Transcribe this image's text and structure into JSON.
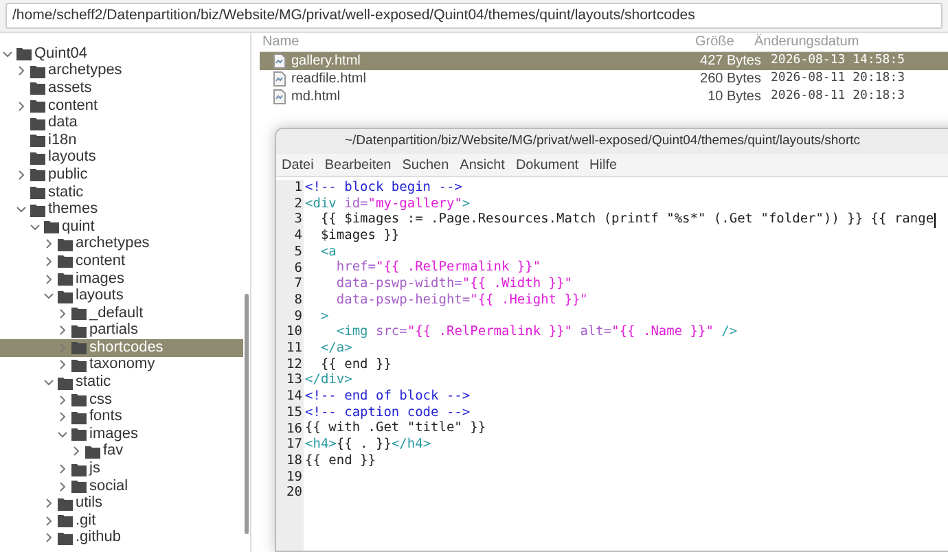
{
  "path_bar": {
    "value": "/home/scheff2/Datenpartition/biz/Website/MG/privat/well-exposed/Quint04/themes/quint/layouts/shortcodes"
  },
  "tree": [
    {
      "label": "Quint04",
      "expanded": true,
      "selected": false,
      "children": [
        {
          "label": "archetypes",
          "expanded": false,
          "selected": false
        },
        {
          "label": "assets",
          "selected": false
        },
        {
          "label": "content",
          "expanded": false,
          "selected": false
        },
        {
          "label": "data",
          "selected": false
        },
        {
          "label": "i18n",
          "selected": false
        },
        {
          "label": "layouts",
          "selected": false
        },
        {
          "label": "public",
          "expanded": false,
          "selected": false
        },
        {
          "label": "static",
          "selected": false
        },
        {
          "label": "themes",
          "expanded": true,
          "selected": false,
          "children": [
            {
              "label": "quint",
              "expanded": true,
              "selected": false,
              "children": [
                {
                  "label": "archetypes",
                  "expanded": false,
                  "selected": false
                },
                {
                  "label": "content",
                  "expanded": false,
                  "selected": false
                },
                {
                  "label": "images",
                  "expanded": false,
                  "selected": false
                },
                {
                  "label": "layouts",
                  "expanded": true,
                  "selected": false,
                  "children": [
                    {
                      "label": "_default",
                      "expanded": false,
                      "selected": false
                    },
                    {
                      "label": "partials",
                      "expanded": false,
                      "selected": false
                    },
                    {
                      "label": "shortcodes",
                      "expanded": false,
                      "selected": true
                    },
                    {
                      "label": "taxonomy",
                      "expanded": false,
                      "selected": false
                    }
                  ]
                },
                {
                  "label": "static",
                  "expanded": true,
                  "selected": false,
                  "children": [
                    {
                      "label": "css",
                      "expanded": false,
                      "selected": false
                    },
                    {
                      "label": "fonts",
                      "expanded": false,
                      "selected": false
                    },
                    {
                      "label": "images",
                      "expanded": true,
                      "selected": false,
                      "children": [
                        {
                          "label": "fav",
                          "expanded": false,
                          "selected": false
                        }
                      ]
                    },
                    {
                      "label": "js",
                      "expanded": false,
                      "selected": false
                    },
                    {
                      "label": "social",
                      "expanded": false,
                      "selected": false
                    }
                  ]
                },
                {
                  "label": "utils",
                  "expanded": false,
                  "selected": false
                },
                {
                  "label": ".git",
                  "expanded": false,
                  "selected": false
                },
                {
                  "label": ".github",
                  "expanded": false,
                  "selected": false
                }
              ]
            }
          ]
        }
      ]
    }
  ],
  "file_list": {
    "columns": [
      "Name",
      "Größe",
      "Änderungsdatum"
    ],
    "rows": [
      {
        "name": "gallery.html",
        "size": "427 Bytes",
        "date": "2026-08-13 14:58:5",
        "selected": true
      },
      {
        "name": "readfile.html",
        "size": "260 Bytes",
        "date": "2026-08-11 20:18:3",
        "selected": false
      },
      {
        "name": "md.html",
        "size": "10 Bytes",
        "date": "2026-08-11 20:18:3",
        "selected": false
      }
    ]
  },
  "editor": {
    "title": "~/Datenpartition/biz/Website/MG/privat/well-exposed/Quint04/themes/quint/layouts/shortc",
    "menu": [
      "Datei",
      "Bearbeiten",
      "Suchen",
      "Ansicht",
      "Dokument",
      "Hilfe"
    ],
    "lines": [
      {
        "number": "1",
        "cursor": false,
        "segments": [
          {
            "kind": "comment",
            "text": "<!-- block begin -->"
          }
        ]
      },
      {
        "number": "2",
        "cursor": false,
        "segments": [
          {
            "kind": "tag",
            "text": "<div "
          },
          {
            "kind": "attr",
            "text": "id="
          },
          {
            "kind": "string",
            "text": "\"my-gallery\""
          },
          {
            "kind": "tag",
            "text": ">"
          }
        ]
      },
      {
        "number": "3",
        "cursor": true,
        "segments": [
          {
            "kind": "plain",
            "text": "  {{ $images := .Page.Resources.Match (printf \"%s*\" (.Get \"folder\")) }} {{ range"
          }
        ]
      },
      {
        "number": "4",
        "cursor": false,
        "segments": [
          {
            "kind": "plain",
            "text": "  $images }}"
          }
        ]
      },
      {
        "number": "5",
        "cursor": false,
        "segments": [
          {
            "kind": "tag",
            "text": "  <a"
          }
        ]
      },
      {
        "number": "6",
        "cursor": false,
        "segments": [
          {
            "kind": "attr",
            "text": "    href="
          },
          {
            "kind": "string",
            "text": "\"{{ .RelPermalink }}\""
          }
        ]
      },
      {
        "number": "7",
        "cursor": false,
        "segments": [
          {
            "kind": "attr",
            "text": "    data-pswp-width="
          },
          {
            "kind": "string",
            "text": "\"{{ .Width }}\""
          }
        ]
      },
      {
        "number": "8",
        "cursor": false,
        "segments": [
          {
            "kind": "attr",
            "text": "    data-pswp-height="
          },
          {
            "kind": "string",
            "text": "\"{{ .Height }}\""
          }
        ]
      },
      {
        "number": "9",
        "cursor": false,
        "segments": [
          {
            "kind": "tag",
            "text": "  >"
          }
        ]
      },
      {
        "number": "10",
        "cursor": false,
        "segments": [
          {
            "kind": "tag",
            "text": "    <img "
          },
          {
            "kind": "attr",
            "text": "src="
          },
          {
            "kind": "string",
            "text": "\"{{ .RelPermalink }}\""
          },
          {
            "kind": "attr",
            "text": " alt="
          },
          {
            "kind": "string",
            "text": "\"{{ .Name }}\""
          },
          {
            "kind": "tag",
            "text": " />"
          }
        ]
      },
      {
        "number": "11",
        "cursor": false,
        "segments": [
          {
            "kind": "tag",
            "text": "  </a>"
          }
        ]
      },
      {
        "number": "12",
        "cursor": false,
        "segments": [
          {
            "kind": "plain",
            "text": "  {{ end }}"
          }
        ]
      },
      {
        "number": "13",
        "cursor": false,
        "segments": [
          {
            "kind": "tag",
            "text": "</div>"
          }
        ]
      },
      {
        "number": "14",
        "cursor": false,
        "segments": [
          {
            "kind": "comment",
            "text": "<!-- end of block -->"
          }
        ]
      },
      {
        "number": "15",
        "cursor": false,
        "segments": [
          {
            "kind": "comment",
            "text": "<!-- caption code -->"
          }
        ]
      },
      {
        "number": "16",
        "cursor": false,
        "segments": [
          {
            "kind": "plain",
            "text": "{{ with .Get \"title\" }}"
          }
        ]
      },
      {
        "number": "17",
        "cursor": false,
        "segments": [
          {
            "kind": "tag",
            "text": "<h4>"
          },
          {
            "kind": "plain",
            "text": "{{ . }}"
          },
          {
            "kind": "tag",
            "text": "</h4>"
          }
        ]
      },
      {
        "number": "18",
        "cursor": false,
        "segments": [
          {
            "kind": "plain",
            "text": "{{ end }}"
          }
        ]
      },
      {
        "number": "19",
        "cursor": false
      },
      {
        "number": "20",
        "cursor": false
      }
    ]
  }
}
